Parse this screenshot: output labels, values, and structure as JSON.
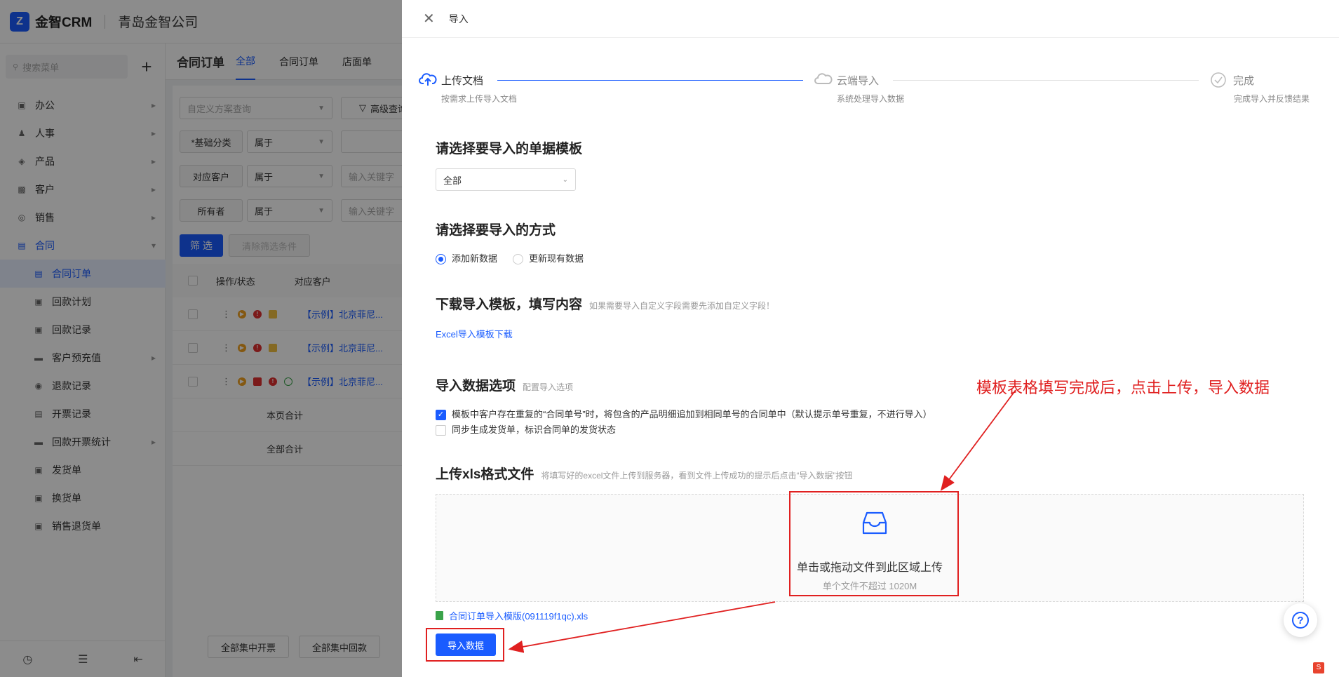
{
  "app": {
    "logo_mark": "Z",
    "name": "金智CRM",
    "company": "青岛金智公司"
  },
  "sidebar": {
    "search_placeholder": "搜索菜单",
    "add_label": "+",
    "items": [
      {
        "label": "办公",
        "icon": "office-icon"
      },
      {
        "label": "人事",
        "icon": "people-icon"
      },
      {
        "label": "产品",
        "icon": "product-icon"
      },
      {
        "label": "客户",
        "icon": "customer-icon"
      },
      {
        "label": "销售",
        "icon": "sales-icon"
      },
      {
        "label": "合同",
        "icon": "contract-icon"
      }
    ],
    "sub_items": [
      {
        "label": "合同订单",
        "active": true
      },
      {
        "label": "回款计划"
      },
      {
        "label": "回款记录"
      },
      {
        "label": "客户预充值"
      },
      {
        "label": "退款记录"
      },
      {
        "label": "开票记录"
      },
      {
        "label": "回款开票统计"
      },
      {
        "label": "发货单"
      },
      {
        "label": "换货单"
      },
      {
        "label": "销售退货单"
      }
    ],
    "bottom_icons": [
      "history-icon",
      "filter-settings-icon",
      "collapse-icon"
    ]
  },
  "main": {
    "page_title": "合同订单",
    "tabs": [
      "全部",
      "合同订单",
      "店面单"
    ],
    "filter": {
      "scheme_placeholder": "自定义方案查询",
      "advanced_label": "高级查询",
      "rows": [
        {
          "label": "*基础分类",
          "op": "属于",
          "value_placeholder": ""
        },
        {
          "label": "对应客户",
          "op": "属于",
          "value_placeholder": "输入关键字"
        },
        {
          "label": "所有者",
          "op": "属于",
          "value_placeholder": "输入关键字"
        }
      ],
      "filter_btn": "筛 选",
      "clear_btn": "清除筛选条件"
    },
    "table": {
      "headers": [
        "操作/状态",
        "对应客户"
      ],
      "rows": [
        {
          "customer": "【示例】北京菲尼..."
        },
        {
          "customer": "【示例】北京菲尼..."
        },
        {
          "customer": "【示例】北京菲尼..."
        }
      ],
      "page_total": "本页合计",
      "all_total": "全部合计",
      "footer_buttons": [
        "全部集中开票",
        "全部集中回款"
      ]
    }
  },
  "drawer": {
    "title": "导入",
    "steps": [
      {
        "title": "上传文档",
        "desc": "按需求上传导入文档",
        "icon": "cloud-upload-icon"
      },
      {
        "title": "云端导入",
        "desc": "系统处理导入数据",
        "icon": "cloud-icon"
      },
      {
        "title": "完成",
        "desc": "完成导入并反馈结果",
        "icon": "check-circle-icon"
      }
    ],
    "template_section": {
      "title": "请选择要导入的单据模板",
      "select_value": "全部"
    },
    "method_section": {
      "title": "请选择要导入的方式",
      "options": [
        "添加新数据",
        "更新现有数据"
      ],
      "selected": "添加新数据"
    },
    "download_section": {
      "title": "下载导入模板，填写内容",
      "note": "如果需要导入自定义字段需要先添加自定义字段！",
      "link": "Excel导入模板下载"
    },
    "options_section": {
      "title": "导入数据选项",
      "note": "配置导入选项",
      "options": [
        {
          "label": "模板中客户存在重复的“合同单号”时，将包含的产品明细追加到相同单号的合同单中（默认提示单号重复，不进行导入）",
          "checked": true
        },
        {
          "label": "同步生成发货单，标识合同单的发货状态",
          "checked": false
        }
      ]
    },
    "upload_section": {
      "title": "上传xls格式文件",
      "note": "将填写好的excel文件上传到服务器，看到文件上传成功的提示后点击“导入数据”按钮",
      "zone_text": "单击或拖动文件到此区域上传",
      "zone_sub": "单个文件不超过 1020M",
      "file_name": "合同订单导入模版(091119f1qc).xls",
      "import_btn": "导入数据"
    },
    "annotation": "模板表格填写完成后，点击上传，导入数据"
  },
  "help_label": "?",
  "corner_badge": "S",
  "colors": {
    "primary": "#1a5cff",
    "annotation_red": "#e02020"
  }
}
